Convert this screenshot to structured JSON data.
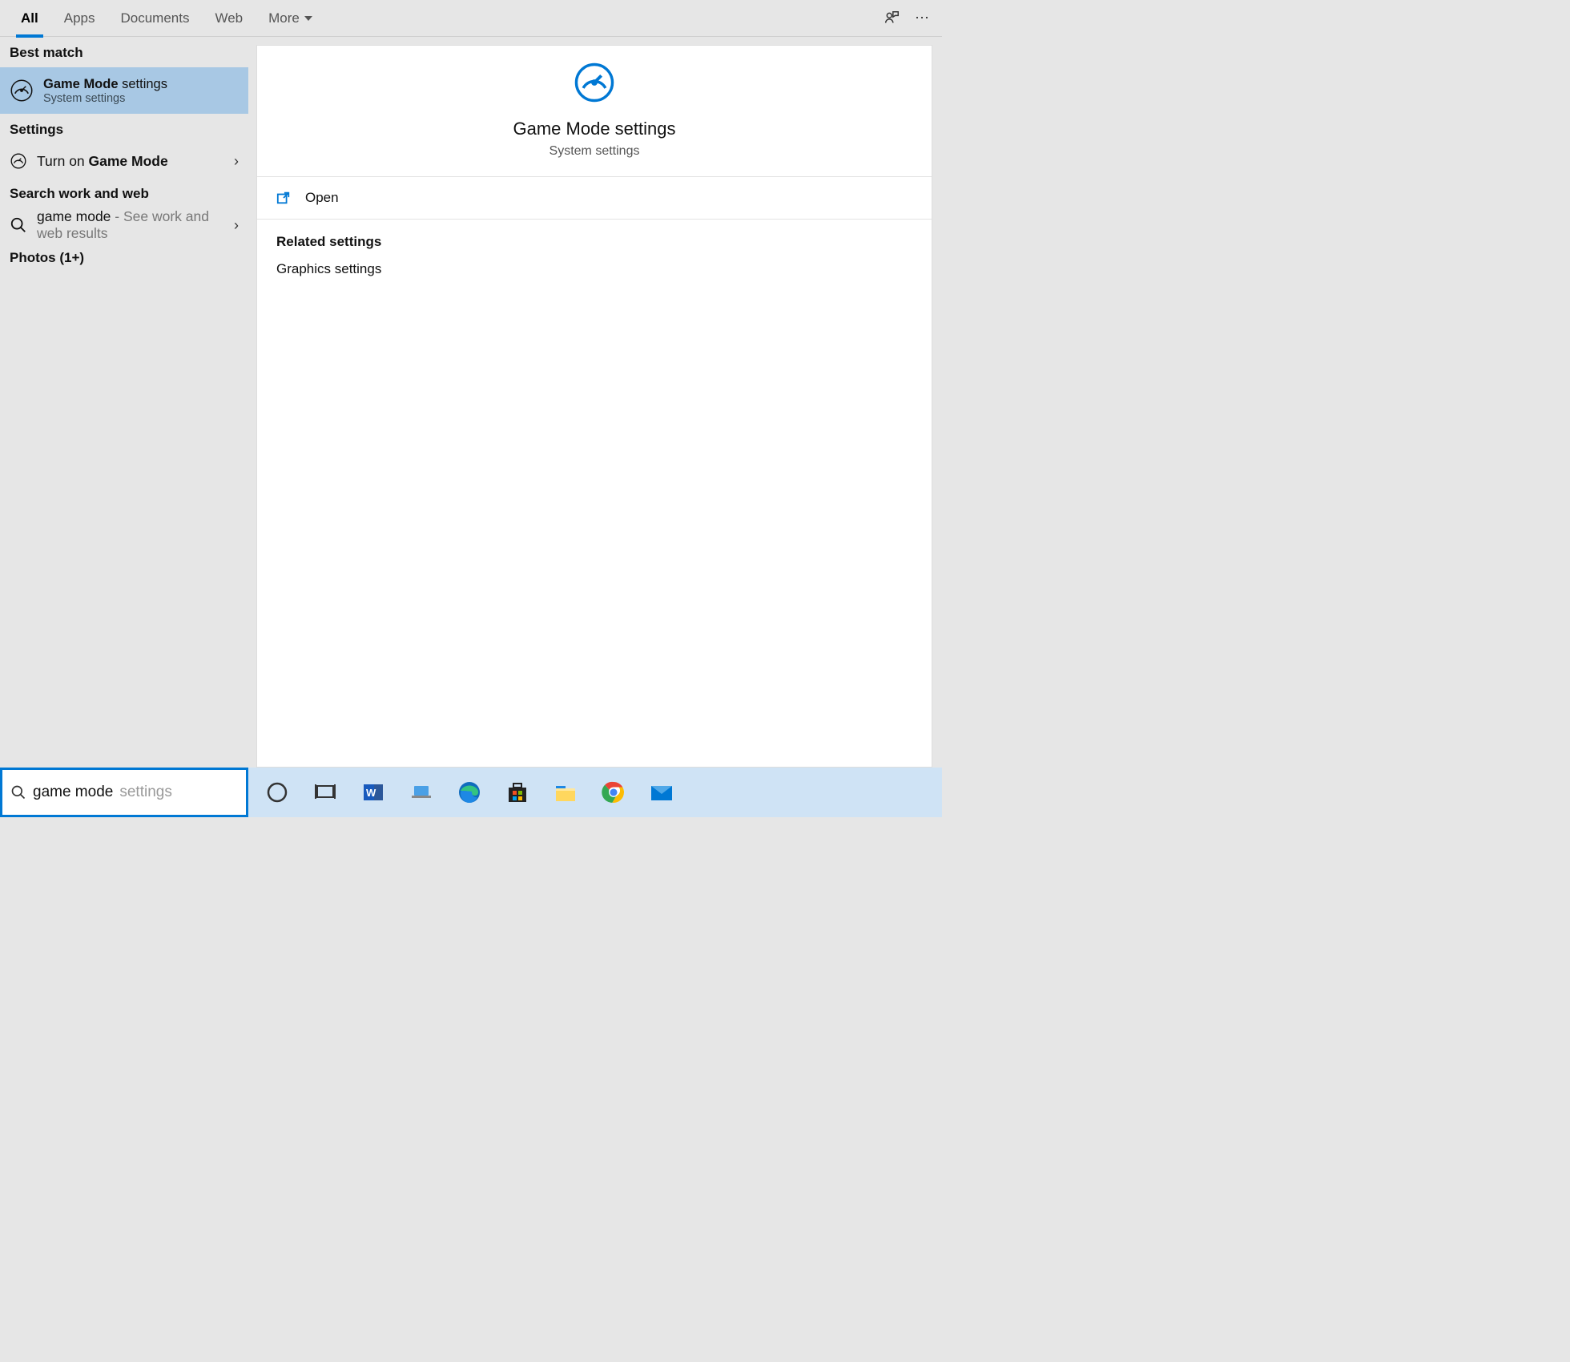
{
  "tabs": {
    "all": "All",
    "apps": "Apps",
    "documents": "Documents",
    "web": "Web",
    "more": "More"
  },
  "sections": {
    "best_match": "Best match",
    "settings": "Settings",
    "search_work_web": "Search work and web",
    "photos": "Photos (1+)"
  },
  "best_match": {
    "title_bold": "Game Mode",
    "title_rest": " settings",
    "subtitle": "System settings"
  },
  "settings_row": {
    "prefix": "Turn on ",
    "bold": "Game Mode"
  },
  "web_row": {
    "query": "game mode",
    "hint": " - See work and web results"
  },
  "preview": {
    "title": "Game Mode settings",
    "subtitle": "System settings",
    "open": "Open",
    "related_label": "Related settings",
    "related_link": "Graphics settings"
  },
  "search": {
    "typed": "game mode",
    "suggest": " settings"
  }
}
